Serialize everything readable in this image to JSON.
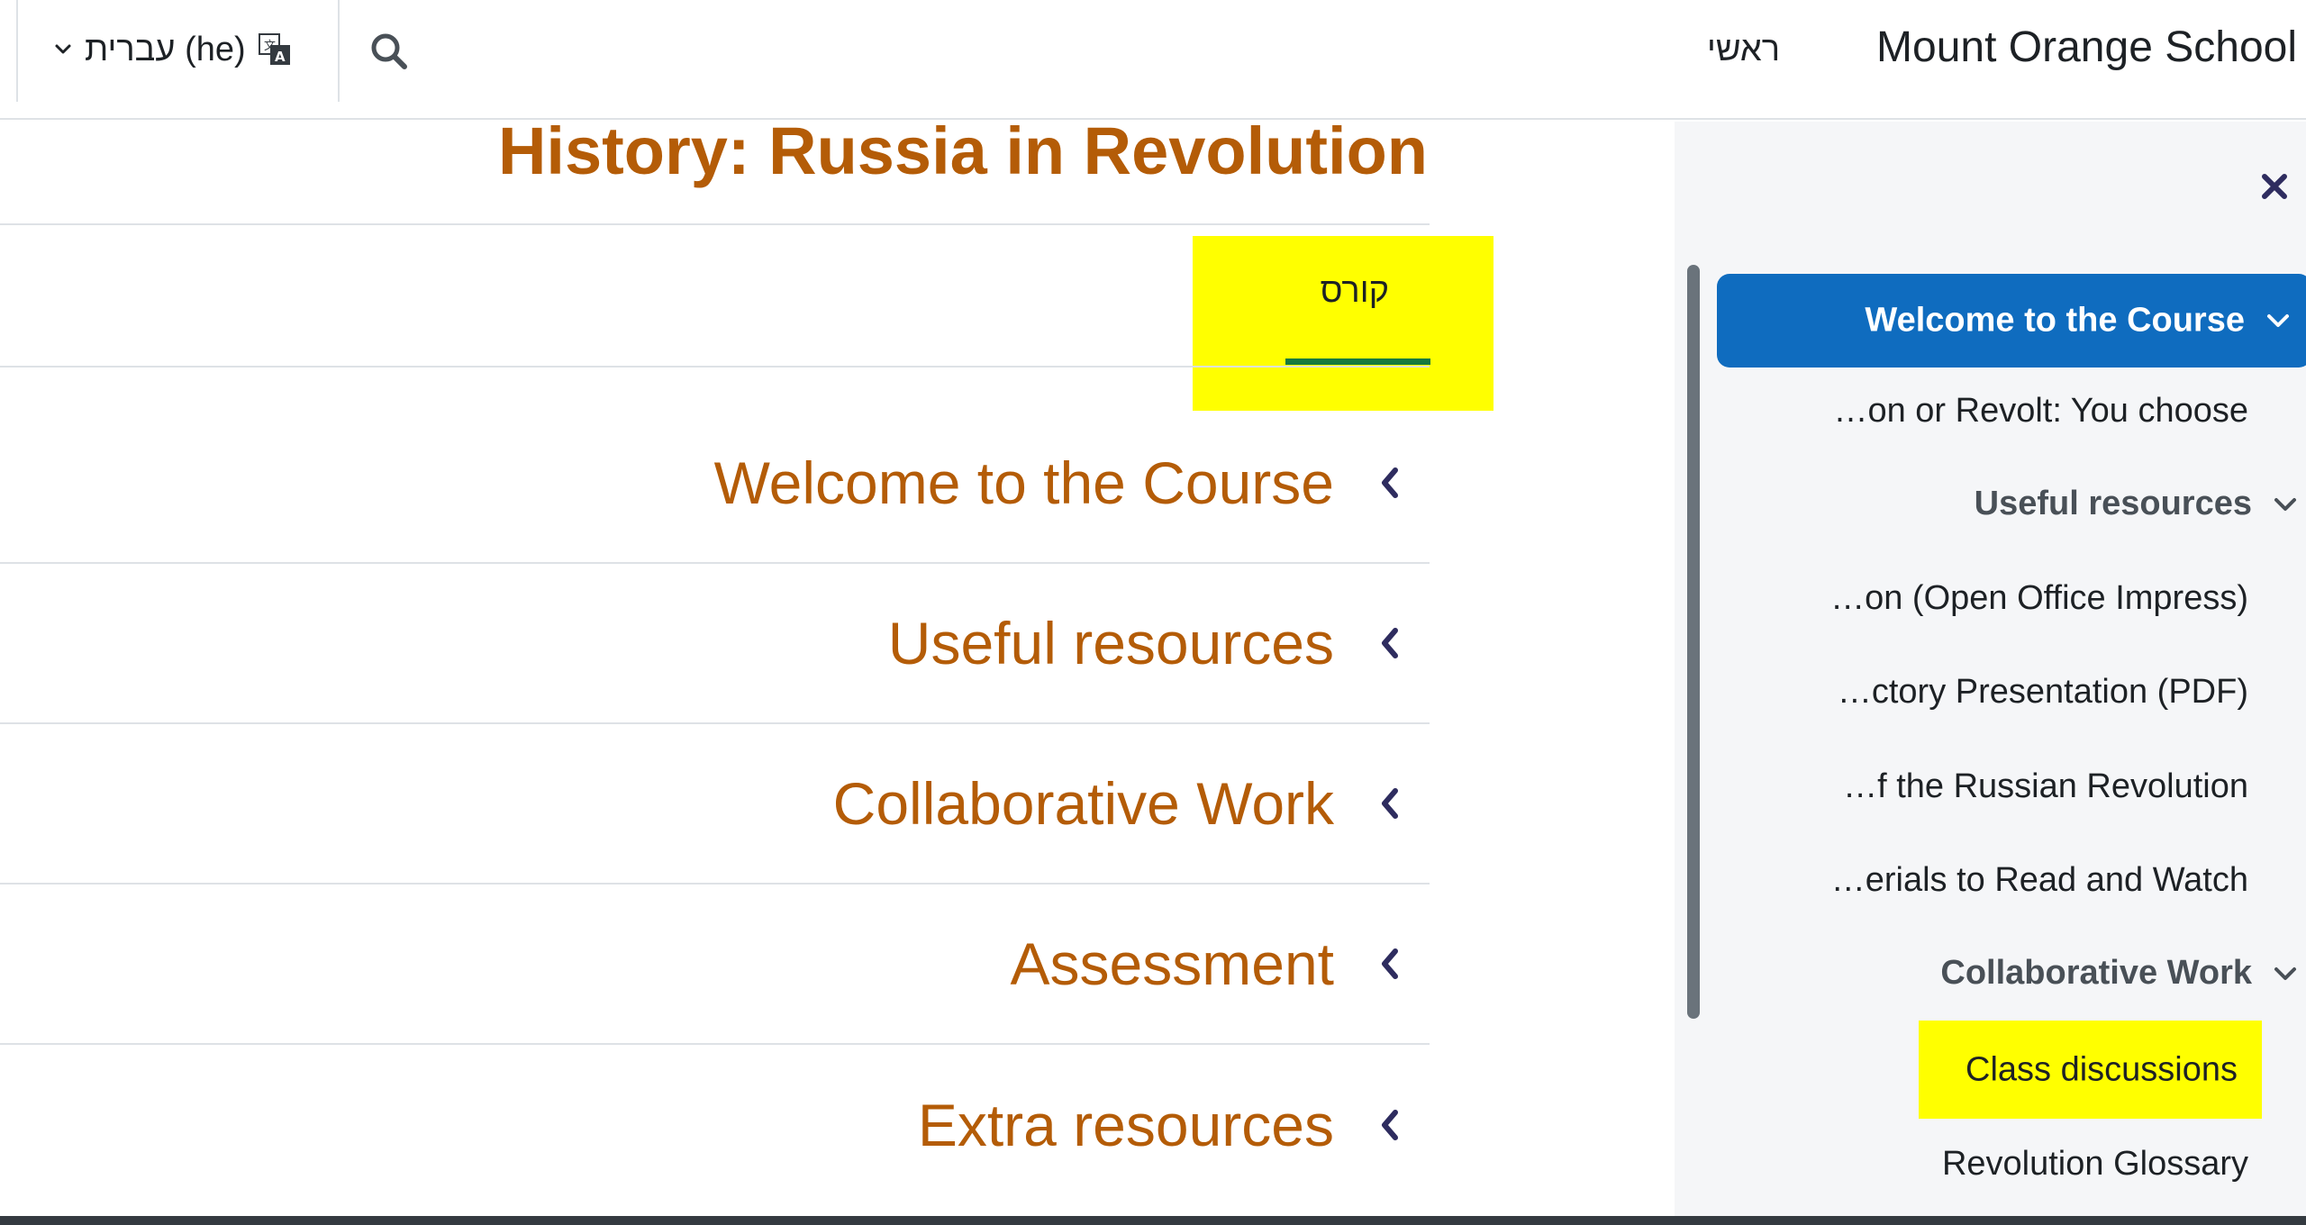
{
  "navbar": {
    "brand": "Mount Orange School",
    "home_link": "ראשי",
    "search_icon": "search-icon",
    "language": {
      "label": "עברית (he)",
      "icon": "language-icon"
    }
  },
  "course": {
    "title": "History: Russia in Revolution",
    "tabs": [
      {
        "label": "קורס",
        "active": true
      }
    ],
    "sections": [
      {
        "title": "Welcome to the Course",
        "icon": "chevron-left-icon"
      },
      {
        "title": "Useful resources",
        "icon": "chevron-left-icon"
      },
      {
        "title": "Collaborative Work",
        "icon": "chevron-left-icon"
      },
      {
        "title": "Assessment",
        "icon": "chevron-left-icon"
      },
      {
        "title": "Extra resources",
        "icon": "chevron-left-icon"
      }
    ]
  },
  "course_index": {
    "close_icon": "close-icon",
    "active_section": "Welcome to the Course",
    "items": [
      {
        "label": "…on or Revolt: You choose"
      },
      {
        "label": "Useful resources",
        "section": true
      },
      {
        "label": "…on (Open Office Impress)"
      },
      {
        "label": "…ctory Presentation (PDF)"
      },
      {
        "label": "…f the Russian Revolution"
      },
      {
        "label": "…erials to Read and Watch"
      },
      {
        "label": "Collaborative Work",
        "section": true
      },
      {
        "label": "Class discussions",
        "highlighted": true
      },
      {
        "label": "Revolution Glossary"
      }
    ]
  },
  "colors": {
    "accent": "#0f6cbf",
    "title": "#b45c07",
    "highlight": "#ffff00",
    "tab_underline": "#157a3f"
  }
}
